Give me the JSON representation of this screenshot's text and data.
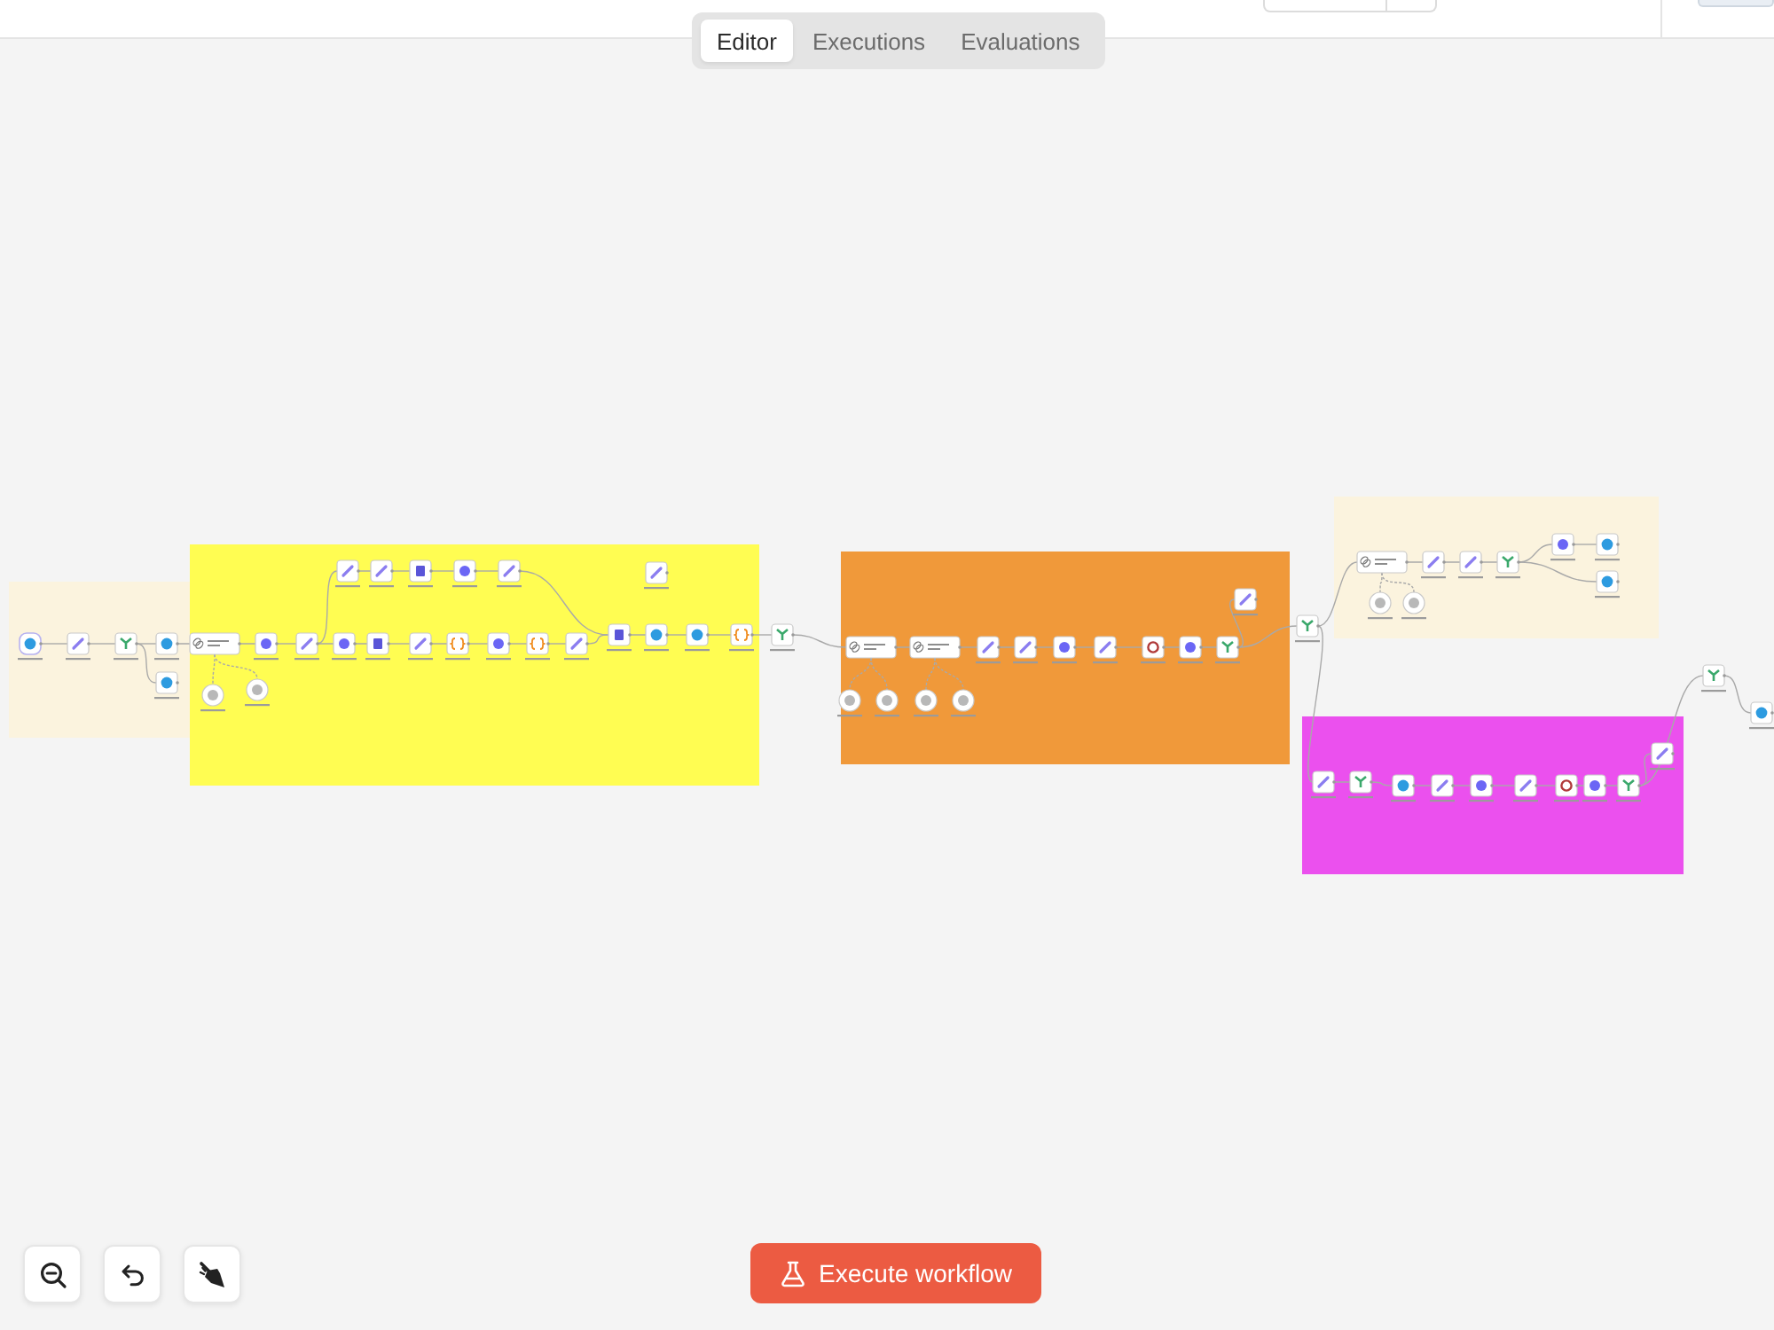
{
  "tabs": [
    {
      "label": "Editor",
      "selected": true
    },
    {
      "label": "Executions",
      "selected": false
    },
    {
      "label": "Evaluations",
      "selected": false
    }
  ],
  "canvas": {
    "sticky_notes": [
      {
        "color": "#fbf3de"
      },
      {
        "color": "#fffd52"
      },
      {
        "color": "#f0993a"
      },
      {
        "color": "#fbf3de"
      },
      {
        "color": "#eb50ee"
      }
    ]
  },
  "execute_button": {
    "label": "Execute workflow"
  }
}
